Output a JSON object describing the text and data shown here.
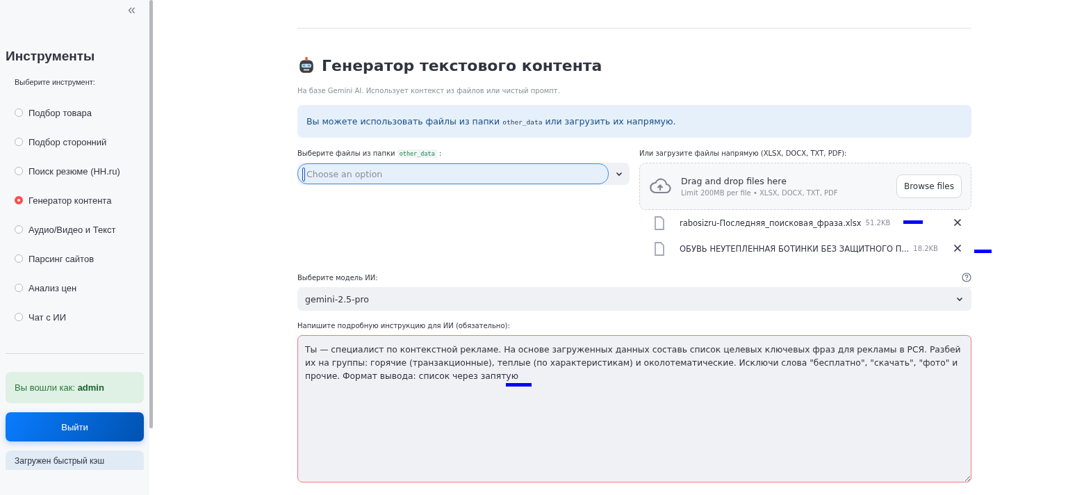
{
  "sidebar": {
    "collapse_icon": "«",
    "title": "Инструменты",
    "radio_label": "Выберите инструмент:",
    "tools": [
      {
        "label": "Подбор товара",
        "selected": false
      },
      {
        "label": "Подбор сторонний",
        "selected": false
      },
      {
        "label": "Поиск резюме (HH.ru)",
        "selected": false
      },
      {
        "label": "Генератор контента",
        "selected": true
      },
      {
        "label": "Аудио/Видео и Текст",
        "selected": false
      },
      {
        "label": "Парсинг сайтов",
        "selected": false
      },
      {
        "label": "Анализ цен",
        "selected": false
      },
      {
        "label": "Чат с ИИ",
        "selected": false
      }
    ],
    "login_note": "Вы вошли как: **admin**",
    "logout_button": "Выйти",
    "cache_note": "Загружен быстрый кэш"
  },
  "main": {
    "title": "Генератор текстового контента",
    "subtitle": "На базе Gemini AI. Использует контекст из файлов или чистый промпт.",
    "info": {
      "before": "Вы можете использовать файлы из папки",
      "code": "other_data",
      "after": "или загрузить их напрямую."
    },
    "folder_select": {
      "label": "Выберите файлы из папки",
      "code": "other_data",
      "label_end": ":",
      "placeholder": "Choose an option"
    },
    "uploader": {
      "label": "Или загрузите файлы напрямую (XLSX, DOCX, TXT, PDF):",
      "drop_title": "Drag and drop files here",
      "drop_hint": "Limit 200MB per file • XLSX, DOCX, TXT, PDF",
      "browse_button": "Browse files",
      "files": [
        {
          "name": "rabosizru-Последняя_поисковая_фраза.xlsx",
          "size": "51.2KB"
        },
        {
          "name": "ОБУВЬ НЕУТЕПЛЕННАЯ БОТИНКИ БЕЗ ЗАЩИТНОГО П...",
          "size": "18.2KB"
        }
      ]
    },
    "model_select": {
      "label": "Выберите модель ИИ:",
      "value": "gemini-2.5-pro"
    },
    "instruction": {
      "label": "Напишите подробную инструкцию для ИИ (обязательно):",
      "value": "Ты — специалист по контекстной рекламе. На основе загруженных данных составь список целевых ключевых фраз для рекламы в РСЯ. Разбей их на группы: горячие (транзакционные), теплые (по характеристикам) и околотематические. Исключи слова \"бесплатно\", \"скачать\", \"фото\" и прочие. Формат вывода: список через запятую"
    }
  }
}
